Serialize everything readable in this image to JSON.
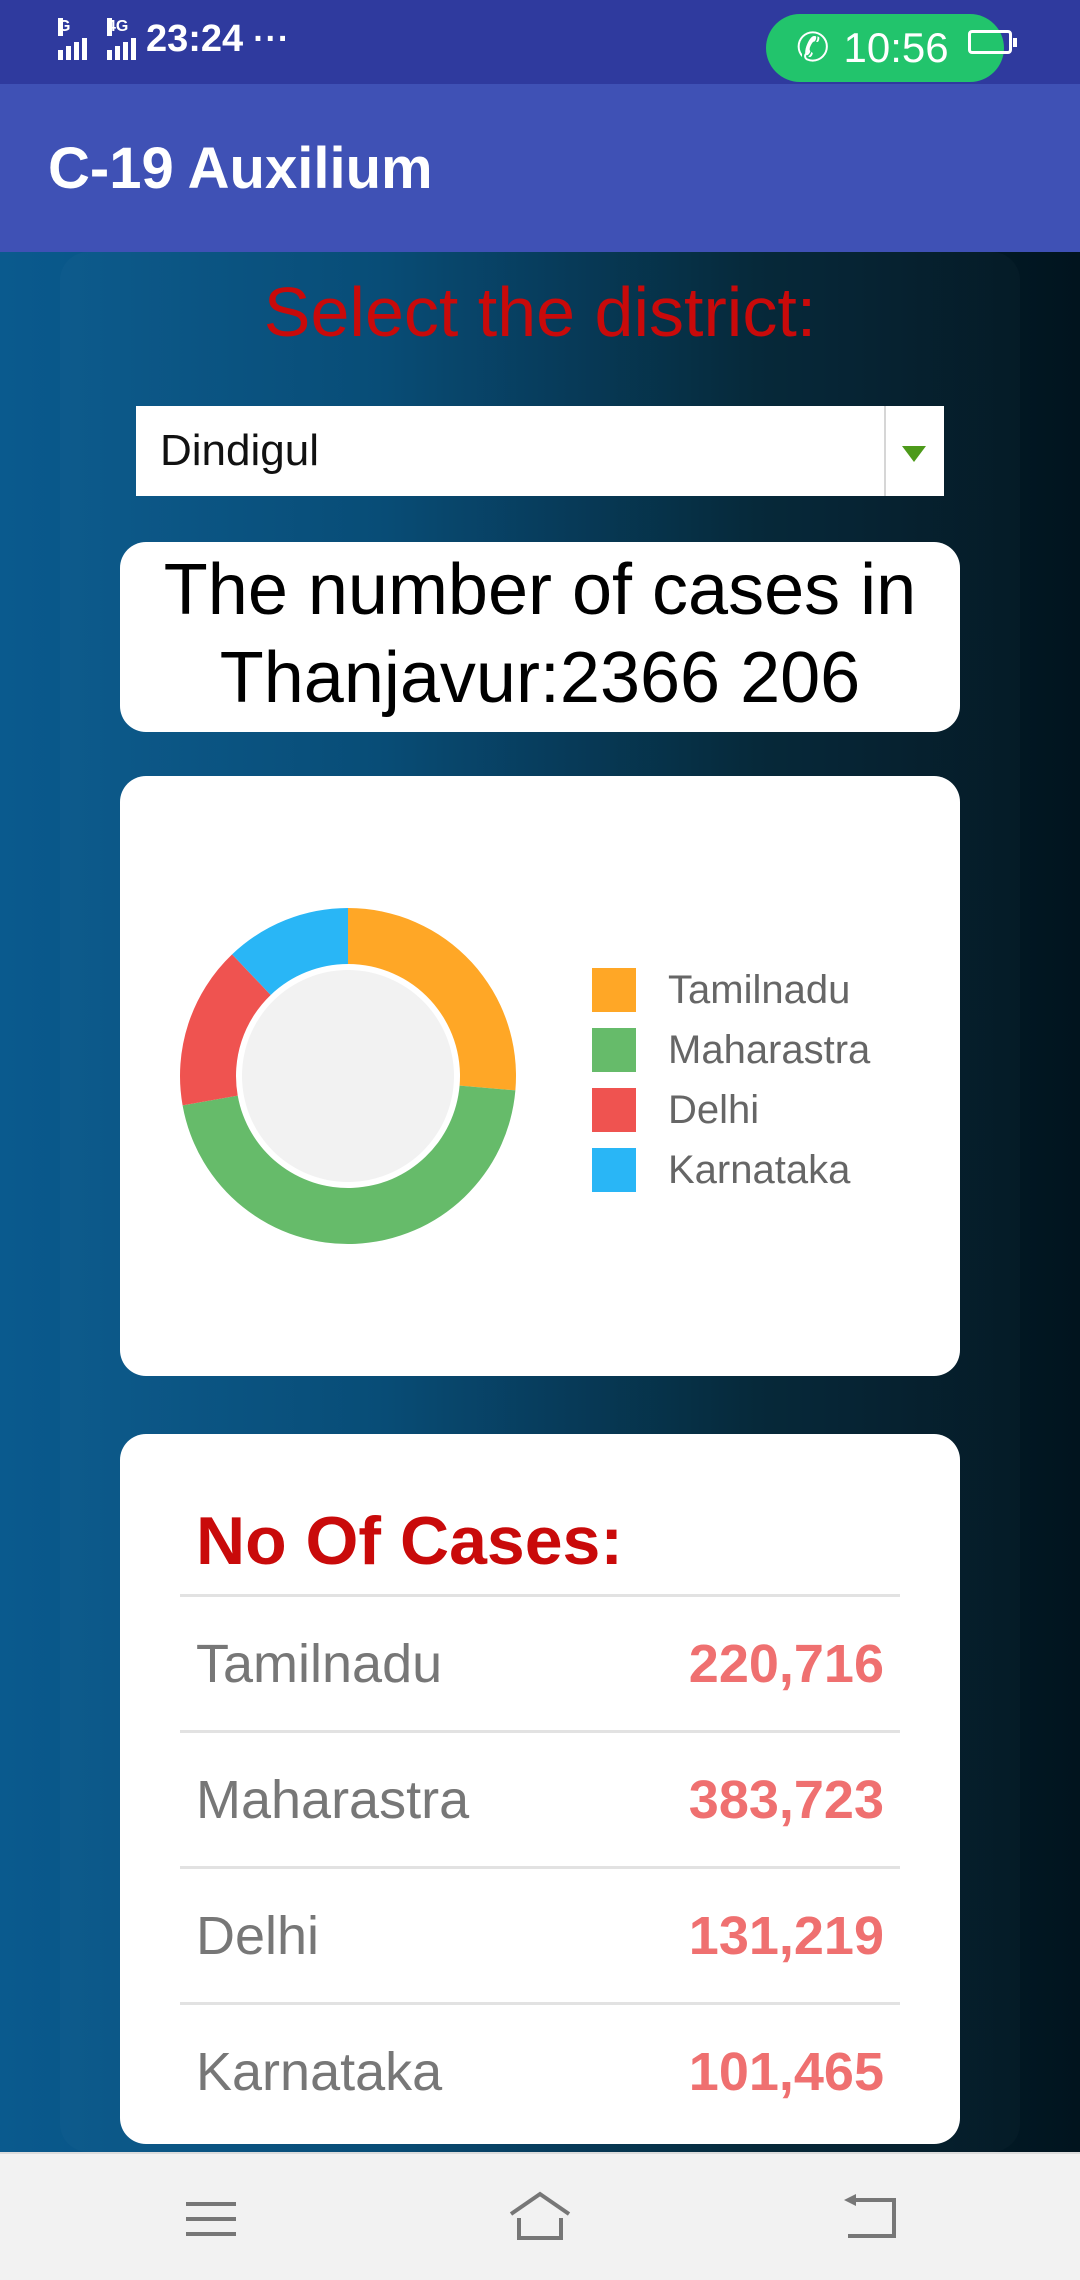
{
  "status_bar": {
    "network_left": "G",
    "network_right": "4G",
    "time": "23:24",
    "more": "···",
    "call_time": "10:56",
    "battery_level": "75"
  },
  "app_bar": {
    "title": "C-19 Auxilium"
  },
  "district_selector": {
    "heading": "Select the district:",
    "selected": "Dindigul"
  },
  "cases_summary": {
    "line1": "The number of cases in",
    "line2": "Thanjavur:2366 206"
  },
  "chart_data": {
    "type": "pie",
    "style": "donut",
    "categories": [
      "Tamilnadu",
      "Maharastra",
      "Delhi",
      "Karnataka"
    ],
    "values": [
      220716,
      383723,
      131219,
      101465
    ],
    "colors": [
      "#ffa726",
      "#66bb6a",
      "#ef5350",
      "#29b6f6"
    ],
    "legend_position": "right"
  },
  "cases_table": {
    "title": "No Of Cases:",
    "rows": [
      {
        "state": "Tamilnadu",
        "value": "220,716"
      },
      {
        "state": "Maharastra",
        "value": "383,723"
      },
      {
        "state": "Delhi",
        "value": "131,219"
      },
      {
        "state": "Karnataka",
        "value": "101,465"
      }
    ]
  },
  "nav_bar": {
    "icons": [
      "menu-icon",
      "home-icon",
      "back-icon"
    ]
  }
}
